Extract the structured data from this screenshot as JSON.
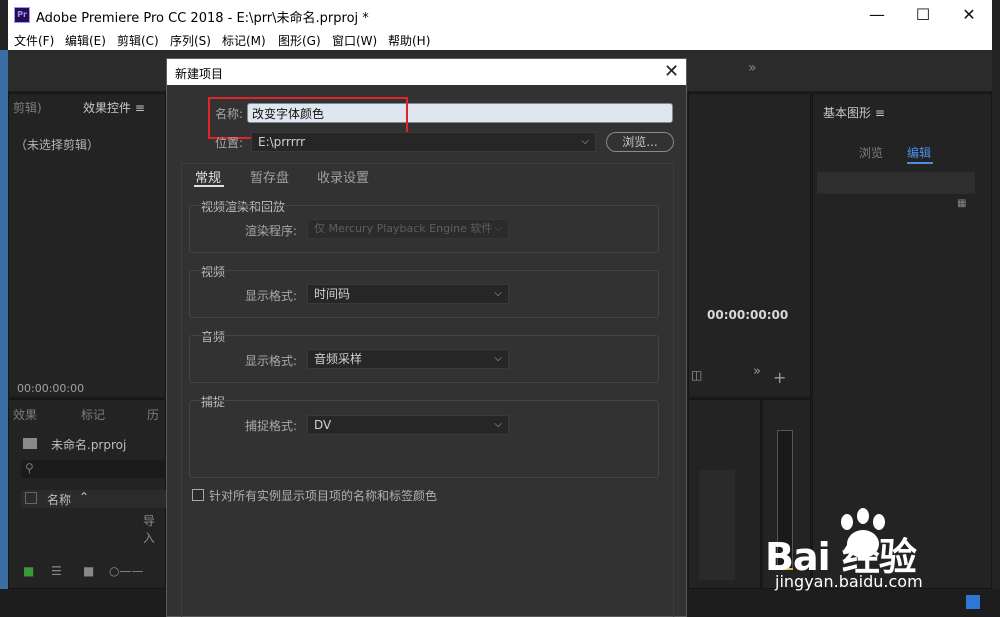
{
  "window": {
    "app_icon": "Pr",
    "title": "Adobe Premiere Pro CC 2018 - E:\\prr\\未命名.prproj *",
    "minimize_icon": "minimize-icon",
    "maximize_icon": "maximize-icon",
    "close_icon": "close-icon"
  },
  "menu": [
    "文件(F)",
    "编辑(E)",
    "剪辑(C)",
    "序列(S)",
    "标记(M)",
    "图形(G)",
    "窗口(W)",
    "帮助(H)"
  ],
  "workspace": {
    "overflow": "»",
    "left_top_tabs": [
      "剪辑)",
      "效果控件 ≡"
    ],
    "no_clip": "（未选择剪辑）",
    "left_timecode": "00:00:00:00",
    "left_bottom_tabs": [
      "效果",
      "标记",
      "历"
    ],
    "project_file": "未命名.prproj",
    "column_name": "名称",
    "import_hint": "导入",
    "right_title": "基本图形 ≡",
    "right_tabs": [
      "浏览",
      "编辑"
    ],
    "program_timecode": "00:00:00:00"
  },
  "dialog": {
    "title": "新建项目",
    "name_label": "名称:",
    "name_value": "改变字体颜色",
    "location_label": "位置:",
    "location_value": "E:\\prrrrr",
    "browse_label": "浏览...",
    "tabs": [
      "常规",
      "暂存盘",
      "收录设置"
    ],
    "active_tab": "常规",
    "groups": {
      "render": {
        "title": "视频渲染和回放",
        "field_label": "渲染程序:",
        "value": "仅 Mercury Playback Engine 软件"
      },
      "video": {
        "title": "视频",
        "field_label": "显示格式:",
        "value": "时间码"
      },
      "audio": {
        "title": "音频",
        "field_label": "显示格式:",
        "value": "音频采样"
      },
      "capture": {
        "title": "捕捉",
        "field_label": "捕捉格式:",
        "value": "DV"
      }
    },
    "checkbox_label": "针对所有实例显示项目项的名称和标签颜色",
    "checkbox_checked": false
  },
  "watermark": {
    "logo": "Bai 经验",
    "url": "jingyan.baidu.com"
  },
  "colors": {
    "highlight": "#e0242a",
    "dialog_bg": "#323232",
    "panel_bg": "#232323"
  }
}
